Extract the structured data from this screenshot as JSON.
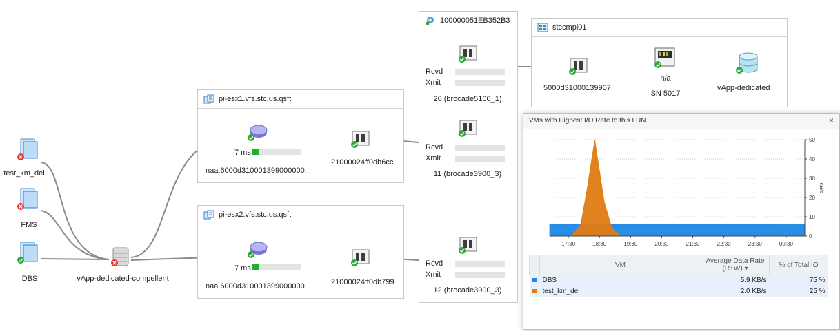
{
  "top_panel": {
    "title": "100000051EB352B3"
  },
  "storage_panel": {
    "title": "stccmpl01",
    "port_label": "5000d31000139907",
    "controller_label": "n/a",
    "controller_sub": "SN 5017",
    "volume_label": "vApp-dedicated"
  },
  "switches": [
    {
      "label": "26 (brocade5100_1)",
      "rcvd": "Rcvd",
      "xmit": "Xmit"
    },
    {
      "label": "11 (brocade3900_3)",
      "rcvd": "Rcvd",
      "xmit": "Xmit"
    },
    {
      "label": "12 (brocade3900_3)",
      "rcvd": "Rcvd",
      "xmit": "Xmit"
    }
  ],
  "hosts": [
    {
      "title": "pi-esx1.vfs.stc.us.qsft",
      "latency": "7 ms",
      "latency_fill": 0.15,
      "lun": "naa.6000d310001399000000...",
      "hba": "21000024ff0db6cc"
    },
    {
      "title": "pi-esx2.vfs.stc.us.qsft",
      "latency": "7 ms",
      "latency_fill": 0.15,
      "lun": "naa.6000d310001399000000...",
      "hba": "21000024ff0db799"
    }
  ],
  "vms": [
    {
      "name": "test_km_del",
      "status": "error"
    },
    {
      "name": "FMS",
      "status": "error"
    },
    {
      "name": "DBS",
      "status": "ok"
    }
  ],
  "datastore": {
    "name": "vApp-dedicated-compellent"
  },
  "popup": {
    "title": "VMs with Highest I/O Rate to this LUN",
    "close": "×",
    "col_vm": "VM",
    "col_rate": "Average Data Rate\n(R+W) ▾",
    "col_pct": "% of Total IO",
    "rows": [
      {
        "name": "DBS",
        "rate": "5.9 KB/s",
        "pct": "75 %",
        "color": "#1e88e5"
      },
      {
        "name": "test_km_del",
        "rate": "2.0 KB/s",
        "pct": "25 %",
        "color": "#e07b12"
      }
    ]
  },
  "chart_data": {
    "type": "area",
    "x_tick_labels": [
      "17:30",
      "18:30",
      "19:30",
      "20:30",
      "21:30",
      "22:30",
      "23:30",
      "00:30"
    ],
    "ylabel": "KB/s",
    "ylim": [
      0,
      50
    ],
    "y_ticks": [
      0,
      10,
      20,
      30,
      40,
      50
    ],
    "series": [
      {
        "name": "test_km_del",
        "color": "#e07b12",
        "x": [
          0,
          0.7,
          1.0,
          1.2,
          1.45,
          1.75,
          2.0,
          2.3,
          8.2
        ],
        "values": [
          0,
          0,
          6,
          24,
          50,
          18,
          4,
          0,
          0
        ]
      },
      {
        "name": "DBS",
        "color": "#1e88e5",
        "x": [
          0,
          1.0,
          1.4,
          1.8,
          2.2,
          2.8,
          3.5,
          4.5,
          5.5,
          6.5,
          7.2,
          7.6,
          8.0,
          8.2
        ],
        "values": [
          6,
          6,
          6,
          6,
          6,
          6,
          6,
          6,
          6,
          6,
          6,
          6.3,
          6.2,
          6
        ]
      }
    ]
  }
}
